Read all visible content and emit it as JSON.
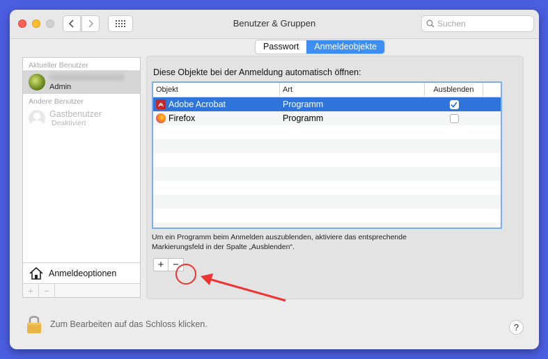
{
  "window": {
    "title": "Benutzer & Gruppen"
  },
  "search": {
    "placeholder": "Suchen"
  },
  "sidebar": {
    "current_heading": "Aktueller Benutzer",
    "current_user": {
      "role": "Admin"
    },
    "other_heading": "Andere Benutzer",
    "guest_user": {
      "name": "Gastbenutzer",
      "status": "Deaktiviert"
    },
    "login_options_label": "Anmeldeoptionen",
    "add_symbol": "+",
    "remove_symbol": "−"
  },
  "tabs": [
    {
      "label": "Passwort",
      "active": false
    },
    {
      "label": "Anmeldeobjekte",
      "active": true
    }
  ],
  "panel": {
    "label": "Diese Objekte bei der Anmeldung automatisch öffnen:",
    "columns": {
      "object": "Objekt",
      "kind": "Art",
      "hide": "Ausblenden"
    },
    "items": [
      {
        "name": "Adobe Acrobat",
        "kind": "Programm",
        "hide": true,
        "icon": "acrobat-icon",
        "selected": true
      },
      {
        "name": "Firefox",
        "kind": "Programm",
        "hide": false,
        "icon": "firefox-icon",
        "selected": false
      }
    ],
    "hint_line1": "Um ein Programm beim Anmelden auszublenden, aktiviere das entsprechende",
    "hint_line2": "Markierungsfeld in der Spalte „Ausblenden“.",
    "add_symbol": "+",
    "remove_symbol": "−"
  },
  "footer": {
    "lock_text": "Zum Bearbeiten auf das Schloss klicken.",
    "help_symbol": "?"
  },
  "colors": {
    "accent": "#2f74db",
    "annotation": "#ee3333",
    "desktop": "#4b5ee0"
  }
}
